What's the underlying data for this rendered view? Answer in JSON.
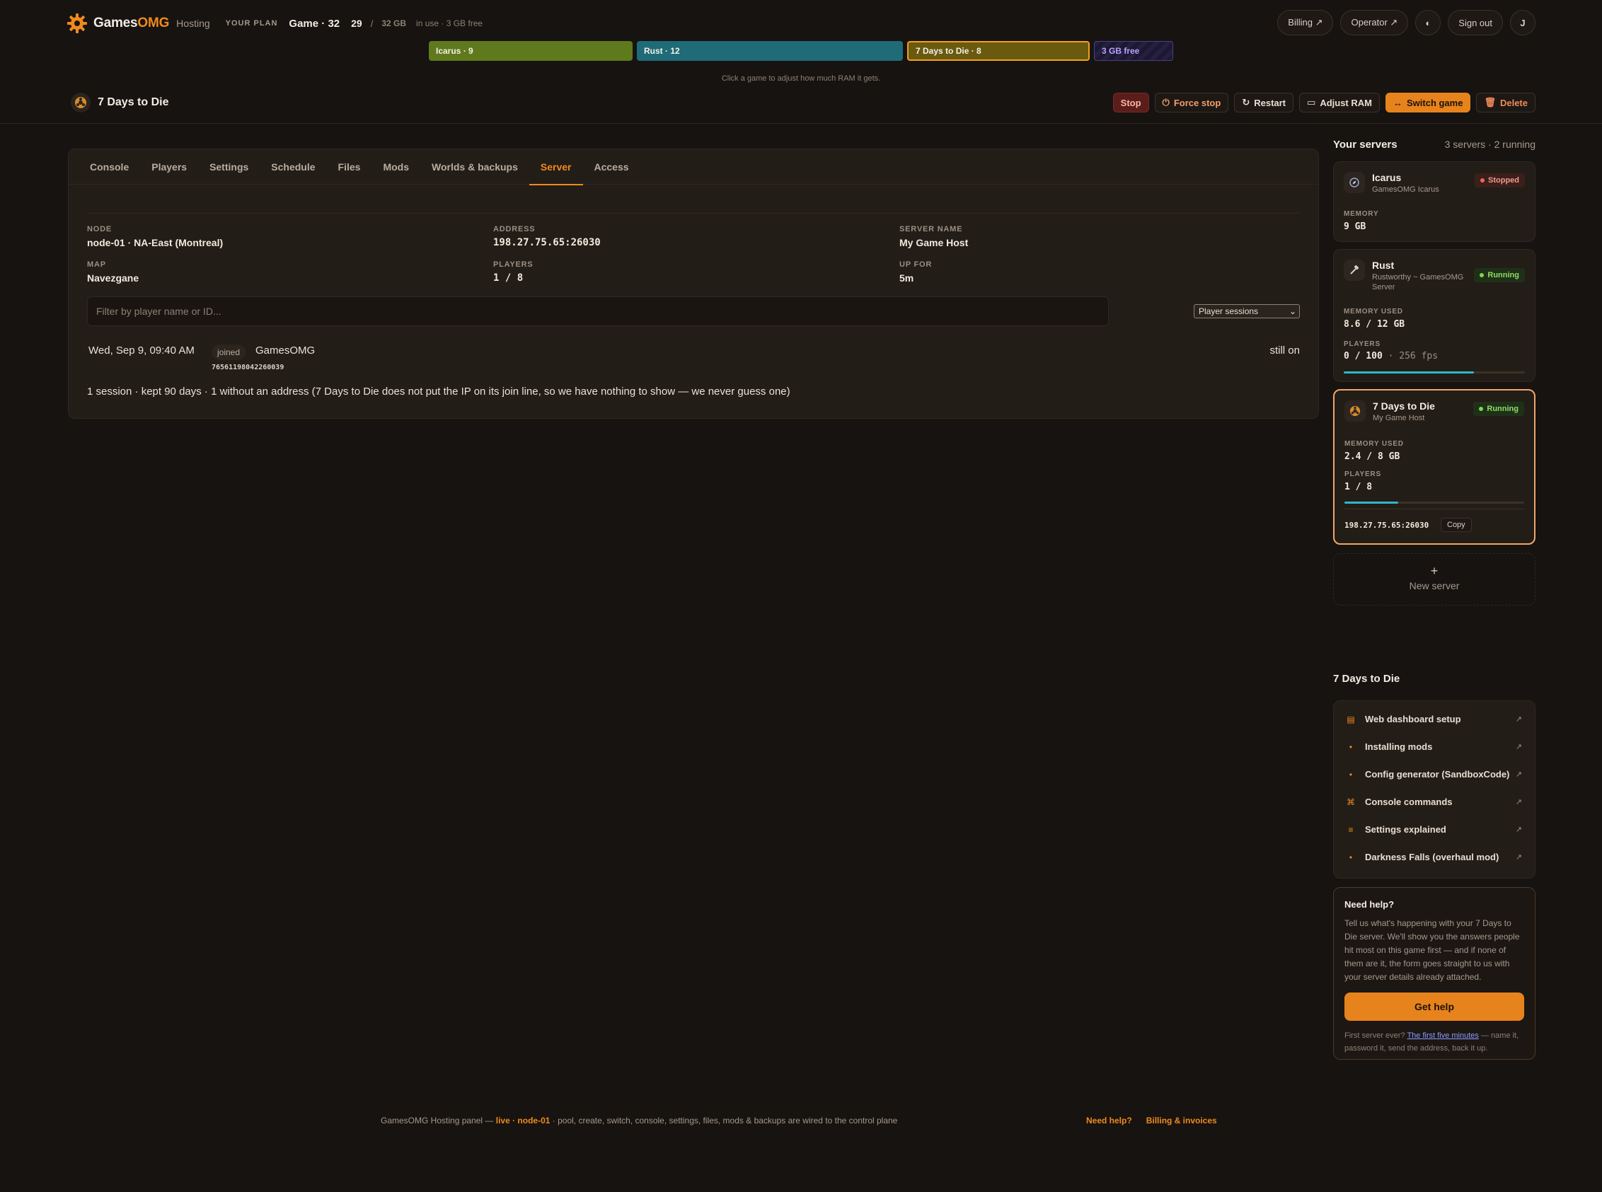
{
  "brand": {
    "name_main": "Games",
    "name_accent": "OMG",
    "sub": "Hosting"
  },
  "plan": {
    "label": "YOUR PLAN",
    "name": "Game · 32",
    "used": "29",
    "slash": "/",
    "total": "32 GB",
    "note": "in use · 3 GB free"
  },
  "top_actions": {
    "billing": "Billing ↗",
    "operator": "Operator ↗",
    "theme_icon": "◐",
    "signout": "Sign out",
    "avatar": "J"
  },
  "ram": {
    "segments": [
      {
        "label": "Icarus · 9",
        "gb": 9
      },
      {
        "label": "Rust · 12",
        "gb": 12
      },
      {
        "label": "7 Days to Die · 8",
        "gb": 8
      },
      {
        "label": "3 GB free",
        "gb": 3
      }
    ],
    "hint": "Click a game to adjust how much RAM it gets."
  },
  "server": {
    "title": "7 Days to Die"
  },
  "head_actions": {
    "stop": "Stop",
    "force_stop": "Force stop",
    "restart": "Restart",
    "adjust_ram": "Adjust RAM",
    "switch_game": "Switch game",
    "delete": "Delete"
  },
  "tabs": [
    "Console",
    "Players",
    "Settings",
    "Schedule",
    "Files",
    "Mods",
    "Worlds & backups",
    "Server",
    "Access"
  ],
  "active_tab": "Server",
  "info": {
    "node": {
      "label": "NODE",
      "value": "node-01 · NA-East (Montreal)"
    },
    "address": {
      "label": "ADDRESS",
      "value": "198.27.75.65:26030"
    },
    "server_name": {
      "label": "SERVER NAME",
      "value": "My Game Host"
    },
    "map": {
      "label": "MAP",
      "value": "Navezgane"
    },
    "players": {
      "label": "PLAYERS",
      "value": "1 / 8"
    },
    "up_for": {
      "label": "UP FOR",
      "value": "5m"
    }
  },
  "filter": {
    "placeholder": "Filter by player name or ID...",
    "select_value": "Player sessions"
  },
  "session": {
    "time": "Wed, Sep 9, 09:40 AM",
    "event": "joined",
    "name": "GamesOMG",
    "id": "76561198042260039",
    "status": "still on"
  },
  "summary": "1 session · kept 90 days · 1 without an address (7 Days to Die does not put the IP on its join line, so we have nothing to show — we never guess one)",
  "sidebar": {
    "title": "Your servers",
    "count": "3 servers · 2 running",
    "servers": [
      {
        "name": "Icarus",
        "sub": "GamesOMG Icarus",
        "status": "Stopped",
        "mem_label": "MEMORY",
        "mem": "9 GB"
      },
      {
        "name": "Rust",
        "sub": "Rustworthy ~ GamesOMG Server",
        "status": "Running",
        "mem_label": "MEMORY USED",
        "mem": "8.6 / 12 GB",
        "players_label": "PLAYERS",
        "players": "0 / 100",
        "extra": "· 256 fps",
        "load": 0.72
      },
      {
        "name": "7 Days to Die",
        "sub": "My Game Host",
        "status": "Running",
        "mem_label": "MEMORY USED",
        "mem": "2.4 / 8 GB",
        "players_label": "PLAYERS",
        "players": "1 / 8",
        "load": 0.3,
        "address": "198.27.75.65:26030",
        "copy": "Copy"
      }
    ],
    "new_server": "New server"
  },
  "guides": {
    "title": "7 Days to Die",
    "items": [
      {
        "icon": "▤",
        "label": "Web dashboard setup"
      },
      {
        "icon": "•",
        "label": "Installing mods"
      },
      {
        "icon": "•",
        "label": "Config generator (SandboxCode)"
      },
      {
        "icon": "⌘",
        "label": "Console commands"
      },
      {
        "icon": "≡",
        "label": "Settings explained"
      },
      {
        "icon": "•",
        "label": "Darkness Falls (overhaul mod)"
      }
    ],
    "ext": "↗"
  },
  "help": {
    "title": "Need help?",
    "body": "Tell us what's happening with your 7 Days to Die server. We'll show you the answers people hit most on this game first — and if none of them are it, the form goes straight to us with your server details already attached.",
    "button": "Get help",
    "foot_pre": "First server ever?",
    "foot_link": "The first five minutes",
    "foot_post": "— name it, password it, send the address, back it up."
  },
  "footer": {
    "pre": "GamesOMG Hosting panel —",
    "live": "live · node-01",
    "post": "· pool, create, switch, console, settings, files, mods & backups are wired to the control plane",
    "link_help": "Need help?",
    "link_billing": "Billing & invoices"
  },
  "colors": {
    "accent": "#f08a1e",
    "bg": "#171310",
    "running": "#7fd94a",
    "stopped": "#f3645a",
    "bar": "#2fb7c9"
  }
}
